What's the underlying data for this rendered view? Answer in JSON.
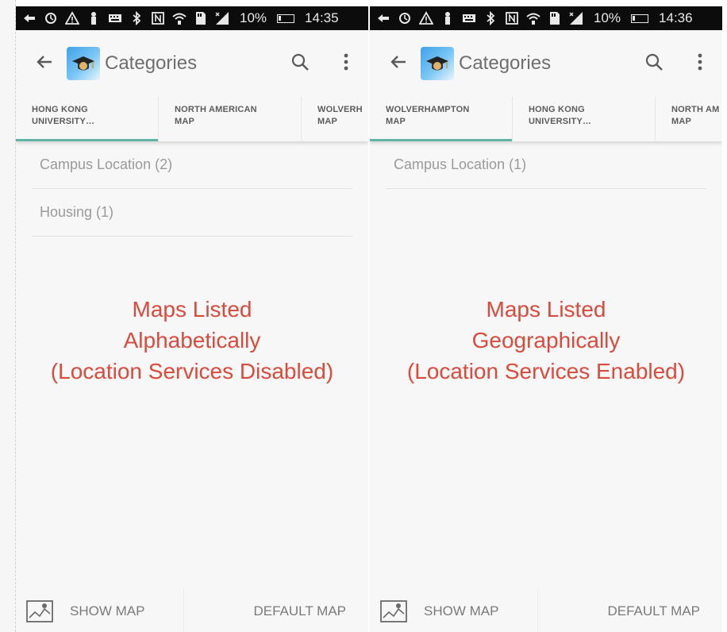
{
  "colors": {
    "status_bar": "#0c0c0c",
    "app_bar": "#f7f7f7",
    "tab_indicator": "#5fb4a6",
    "annotation_text": "#d94b3c",
    "list_text": "#9a9a9a"
  },
  "screens": [
    {
      "status": {
        "icons": [
          "back-arrow-icon",
          "sync-icon",
          "warning-icon",
          "notification-icon",
          "keyboard-icon",
          "bluetooth-icon",
          "nfc-icon",
          "wifi-icon",
          "sd-card-icon",
          "signal-icon"
        ],
        "battery": "10%",
        "time": "14:35"
      },
      "app_bar": {
        "title": "Categories"
      },
      "tabs": [
        {
          "label": "HONG KONG\nUNIVERSITY…",
          "active": true
        },
        {
          "label": "NORTH AMERICAN\nMAP",
          "active": false
        },
        {
          "label": "WOLVERH\nMAP",
          "active": false
        }
      ],
      "list": [
        {
          "label": "Campus Location (2)"
        },
        {
          "label": "Housing (1)"
        }
      ],
      "annotation": {
        "line1": "Maps Listed",
        "line2": "Alphabetically",
        "line3": "(Location Services Disabled)"
      },
      "bottom_bar": {
        "show_map": "SHOW MAP",
        "default_map": "DEFAULT MAP"
      }
    },
    {
      "status": {
        "icons": [
          "back-arrow-icon",
          "sync-icon",
          "warning-icon",
          "notification-icon",
          "keyboard-icon",
          "bluetooth-icon",
          "nfc-icon",
          "wifi-icon",
          "sd-card-icon",
          "signal-icon"
        ],
        "battery": "10%",
        "time": "14:36"
      },
      "app_bar": {
        "title": "Categories"
      },
      "tabs": [
        {
          "label": "WOLVERHAMPTON\nMAP",
          "active": true
        },
        {
          "label": "HONG KONG\nUNIVERSITY…",
          "active": false
        },
        {
          "label": "NORTH AM\nMAP",
          "active": false
        }
      ],
      "list": [
        {
          "label": "Campus Location (1)"
        }
      ],
      "annotation": {
        "line1": "Maps Listed",
        "line2": "Geographically",
        "line3": "(Location Services Enabled)"
      },
      "bottom_bar": {
        "show_map": "SHOW MAP",
        "default_map": "DEFAULT MAP"
      }
    }
  ]
}
